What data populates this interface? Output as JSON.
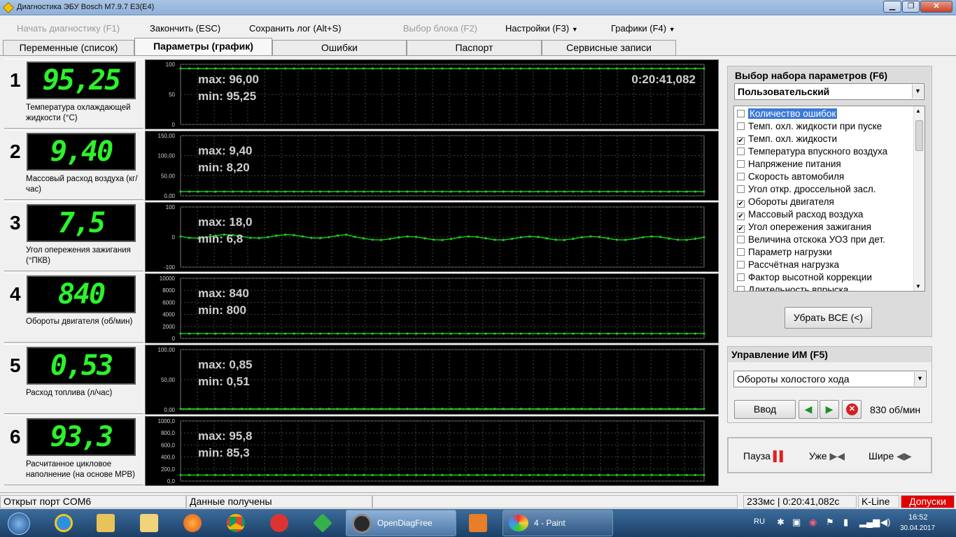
{
  "window": {
    "title": "Диагностика ЭБУ Bosch M7.9.7 E3(E4)"
  },
  "menu": {
    "start": "Начать диагностику (F1)",
    "finish": "Закончить (ESC)",
    "save_log": "Сохранить лог (Alt+S)",
    "select_block": "Выбор блока (F2)",
    "settings": "Настройки (F3)",
    "graphs": "Графики (F4)"
  },
  "tabs": [
    "Переменные (список)",
    "Параметры (график)",
    "Ошибки",
    "Паспорт",
    "Сервисные записи"
  ],
  "rows": [
    {
      "num": "1",
      "value": "95,25",
      "label": "Температура охлаждающей жидкости (°C)",
      "max": "max: 96,00",
      "min": "min: 95,25",
      "ticks": [
        "100",
        "50",
        "0"
      ],
      "time": "0:20:41,082"
    },
    {
      "num": "2",
      "value": "9,40",
      "label": "Массовый расход воздуха (кг/час)",
      "max": "max: 9,40",
      "min": "min: 8,20",
      "ticks": [
        "150,00",
        "100,00",
        "50,00",
        "0,00"
      ]
    },
    {
      "num": "3",
      "value": "7,5",
      "label": "Угол опережения зажигания (°ПКВ)",
      "max": "max: 18,0",
      "min": "min: 6,8",
      "ticks": [
        "100",
        "0",
        "-100"
      ]
    },
    {
      "num": "4",
      "value": "840",
      "label": "Обороты двигателя (об/мин)",
      "max": "max: 840",
      "min": "min: 800",
      "ticks": [
        "10000",
        "8000",
        "6000",
        "4000",
        "2000",
        "0"
      ]
    },
    {
      "num": "5",
      "value": "0,53",
      "label": "Расход топлива (л/час)",
      "max": "max: 0,85",
      "min": "min: 0,51",
      "ticks": [
        "100,00",
        "50,00",
        "0,00"
      ]
    },
    {
      "num": "6",
      "value": "93,3",
      "label": "Расчитанное цикловое наполнение (на основе МРВ)",
      "max": "max: 95,8",
      "min": "min: 85,3",
      "ticks": [
        "1000,0",
        "800,0",
        "600,0",
        "400,0",
        "200,0",
        "0,0"
      ]
    }
  ],
  "paramset": {
    "title": "Выбор набора параметров (F6)",
    "selected": "Пользовательский",
    "items": [
      {
        "label": "Количество ошибок",
        "checked": false,
        "selected": true
      },
      {
        "label": "Темп. охл. жидкости при пуске",
        "checked": false
      },
      {
        "label": "Темп. охл. жидкости",
        "checked": true
      },
      {
        "label": "Температура впускного воздуха",
        "checked": false
      },
      {
        "label": "Напряжение питания",
        "checked": false
      },
      {
        "label": "Скорость автомобиля",
        "checked": false
      },
      {
        "label": "Угол откр. дроссельной засл.",
        "checked": false
      },
      {
        "label": "Обороты двигателя",
        "checked": true
      },
      {
        "label": "Массовый расход воздуха",
        "checked": true
      },
      {
        "label": "Угол опережения зажигания",
        "checked": true
      },
      {
        "label": "Величина отскока УОЗ при дет.",
        "checked": false
      },
      {
        "label": "Параметр нагрузки",
        "checked": false
      },
      {
        "label": "Рассчётная нагрузка",
        "checked": false
      },
      {
        "label": "Фактор высотной коррекции",
        "checked": false
      },
      {
        "label": "Длительность впрыска",
        "checked": false
      }
    ],
    "remove_all": "Убрать ВСЕ (<)"
  },
  "control": {
    "title": "Управление ИМ (F5)",
    "selected": "Обороты холостого хода",
    "enter": "Ввод",
    "value": "830 об/мин"
  },
  "playback": {
    "pause": "Пауза",
    "narrow": "Уже",
    "wide": "Шире"
  },
  "status": {
    "port": "Открыт порт COM6",
    "data": "Данные получены",
    "timing": "233мс | 0:20:41,082с",
    "protocol": "K-Line",
    "tolerances": "Допуски"
  },
  "taskbar": {
    "opendiag": "OpenDiagFree",
    "paint": "4 - Paint",
    "lang": "RU",
    "time": "16:52",
    "date": "30.04.2017"
  },
  "colors": {
    "lcd_green": "#2cf22c",
    "trace_green": "#1ecc1e",
    "status_red": "#e20000"
  }
}
